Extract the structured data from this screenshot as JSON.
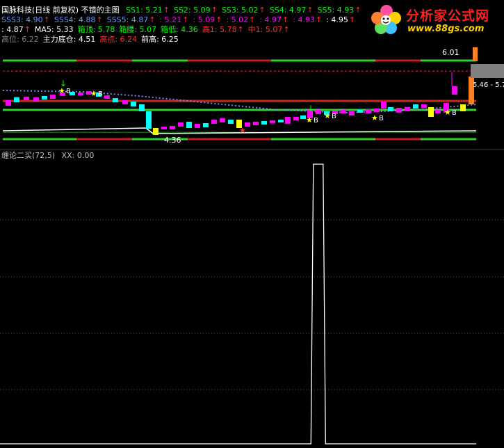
{
  "header": {
    "title": "国脉科技(日线 前复权) 不错的主图",
    "row1": [
      {
        "label": "SS1: 5.21",
        "color": "#00ff00"
      },
      {
        "label": "SS2: 5.09",
        "color": "#00ff00"
      },
      {
        "label": "SS3: 5.02",
        "color": "#00ff00"
      },
      {
        "label": "SS4: 4.97",
        "color": "#00ff00"
      },
      {
        "label": "SS5: 4.93",
        "color": "#00ff00"
      }
    ],
    "row2": [
      {
        "label": "SSS3: 4.90",
        "color": "#6699ff"
      },
      {
        "label": "SSS4: 4.88",
        "color": "#6699ff"
      },
      {
        "label": "SSS5: 4.87",
        "color": "#6699ff"
      },
      {
        "label": ": 5.21",
        "color": "#ff00ff"
      },
      {
        "label": ": 5.09",
        "color": "#ff00ff"
      },
      {
        "label": ": 5.02",
        "color": "#ff00ff"
      },
      {
        "label": ": 4.97",
        "color": "#ff00ff"
      },
      {
        "label": ": 4.93",
        "color": "#ff00ff"
      },
      {
        "label": ": 4.95",
        "color": "#ffffff"
      }
    ],
    "row3": [
      {
        "label": ": 4.87",
        "color": "#ffffff",
        "arrow": true
      },
      {
        "label": "MA5: 5.33",
        "color": "#ffffff",
        "arrow": false
      },
      {
        "label": "箱顶: 5.78",
        "color": "#00ff00",
        "arrow": false
      },
      {
        "label": "箱腰: 5.07",
        "color": "#00ff00",
        "arrow": false
      },
      {
        "label": "箱低: 4.36",
        "color": "#00ff00",
        "arrow": false
      },
      {
        "label": "高1: 5.78",
        "color": "#ff3030",
        "arrow": true
      },
      {
        "label": "中1: 5.07",
        "color": "#ff3030",
        "arrow": true
      }
    ],
    "row4": [
      {
        "label": "高位: 6.22",
        "color": "#808080"
      },
      {
        "label": "主力底仓: 4.51",
        "color": "#ffffff"
      },
      {
        "label": "高点: 6.24",
        "color": "#ff3030"
      },
      {
        "label": "前高: 6.25",
        "color": "#ffffff"
      }
    ]
  },
  "logo": {
    "title": "分析家公式网",
    "url": "www.88gs.com"
  },
  "price_markers": {
    "high_label": "6.01",
    "low_label": "4.36",
    "right_label": "5.46 - 5.7",
    "buy_marker": "B"
  },
  "colors": {
    "background": "#000000",
    "up": "#ff00ff",
    "down": "#00ffff",
    "band_red": "#c81e1e",
    "band_green": "#30d030",
    "white_line": "#ffffff",
    "grid": "#555555"
  },
  "indicator": {
    "title": "缠论二买(72,5)",
    "value_label": "XX: 0.00"
  },
  "chart_data": [
    {
      "type": "line",
      "title": "国脉科技(日线 前复权) 不错的主图",
      "xlabel": "",
      "ylabel": "",
      "ylim": [
        4.2,
        6.3
      ],
      "grid": false,
      "legend": "top-left",
      "series": [
        {
          "name": "箱顶",
          "values": [
            5.78,
            5.78
          ]
        },
        {
          "name": "箱腰",
          "values": [
            5.07,
            5.07
          ]
        },
        {
          "name": "箱低",
          "values": [
            4.36,
            4.36
          ]
        }
      ],
      "annotations": [
        "6.01",
        "4.36",
        "5.46 - 5.7"
      ]
    },
    {
      "type": "line",
      "title": "缠论二买(72,5)",
      "xlabel": "",
      "ylabel": "",
      "ylim": [
        0,
        1
      ],
      "grid": true,
      "legend": "top-left",
      "series": [
        {
          "name": "XX",
          "values": [
            0,
            0,
            0,
            0,
            0,
            0,
            0,
            0,
            0,
            0,
            0,
            0,
            0,
            0,
            0,
            0,
            0,
            0,
            0,
            0,
            0,
            0,
            0,
            0,
            0,
            0,
            0,
            0,
            0,
            0,
            0,
            0,
            0,
            0,
            0,
            0,
            0,
            0,
            0,
            0,
            0,
            0,
            0,
            0,
            0,
            0,
            0,
            0,
            0,
            0,
            0,
            0,
            0,
            0,
            0,
            0,
            0,
            0,
            0,
            0,
            0,
            0,
            0,
            0,
            0,
            0,
            0,
            0,
            0,
            0,
            0,
            0,
            0,
            0,
            0,
            0,
            0,
            0,
            0,
            0,
            0,
            0,
            0,
            0,
            0,
            0,
            0,
            0,
            0,
            0,
            0,
            0,
            0,
            0,
            0,
            0,
            0,
            0,
            0,
            0,
            0,
            0,
            0,
            0,
            0,
            0,
            0,
            0,
            0,
            0,
            0,
            0,
            0,
            0,
            0,
            0,
            0,
            0,
            0,
            0,
            0,
            0,
            0,
            0,
            0,
            0,
            0,
            0,
            0,
            1,
            1,
            1,
            1,
            1,
            0,
            0,
            0,
            0,
            0,
            0,
            0,
            0,
            0,
            0,
            0,
            0,
            0,
            0,
            0,
            0,
            0,
            0,
            0,
            0,
            0,
            0,
            0,
            0,
            0,
            0,
            0,
            0,
            0,
            0,
            0,
            0,
            0,
            0,
            0,
            0,
            0,
            0,
            0,
            0,
            0,
            0,
            0,
            0,
            0,
            0,
            0,
            0,
            0,
            0,
            0,
            0,
            0,
            0,
            0,
            0,
            0,
            0,
            0,
            0,
            0,
            0,
            0
          ]
        }
      ]
    }
  ]
}
